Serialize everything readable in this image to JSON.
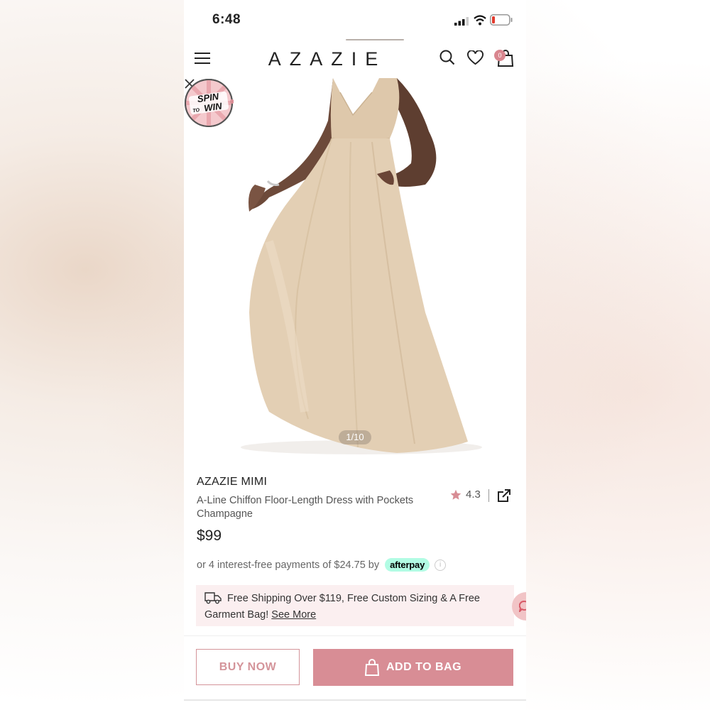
{
  "status_bar": {
    "time": "6:48"
  },
  "header": {
    "logo": "AZAZIE",
    "bag_count": "0"
  },
  "gallery": {
    "pager": "1/10",
    "badge_line1": "SPIN",
    "badge_line2": "TO",
    "badge_line3": "WIN"
  },
  "product": {
    "brand": "AZAZIE MIMI",
    "subtitle": "A-Line Chiffon Floor-Length Dress with Pockets Champagne",
    "rating": "4.3",
    "price": "$99",
    "afterpay_text": "or 4 interest-free payments of $24.75 by",
    "afterpay_badge": "afterpay",
    "info": "i"
  },
  "promo": {
    "text": "Free Shipping Over $119, Free Custom Sizing & A Free Garment Bag!",
    "link": "See More"
  },
  "actions": {
    "buy_now": "BUY NOW",
    "add_to_bag": "ADD TO BAG"
  },
  "colors": {
    "accent": "#d88d95",
    "promo_bg": "#fbeff0",
    "afterpay": "#b2fce4",
    "dress": "#e3cfb4"
  },
  "icons": [
    "menu-icon",
    "search-icon",
    "heart-icon",
    "bag-icon",
    "close-icon",
    "star-icon",
    "share-icon",
    "truck-icon",
    "chat-icon",
    "signal-icon",
    "wifi-icon",
    "battery-icon"
  ]
}
